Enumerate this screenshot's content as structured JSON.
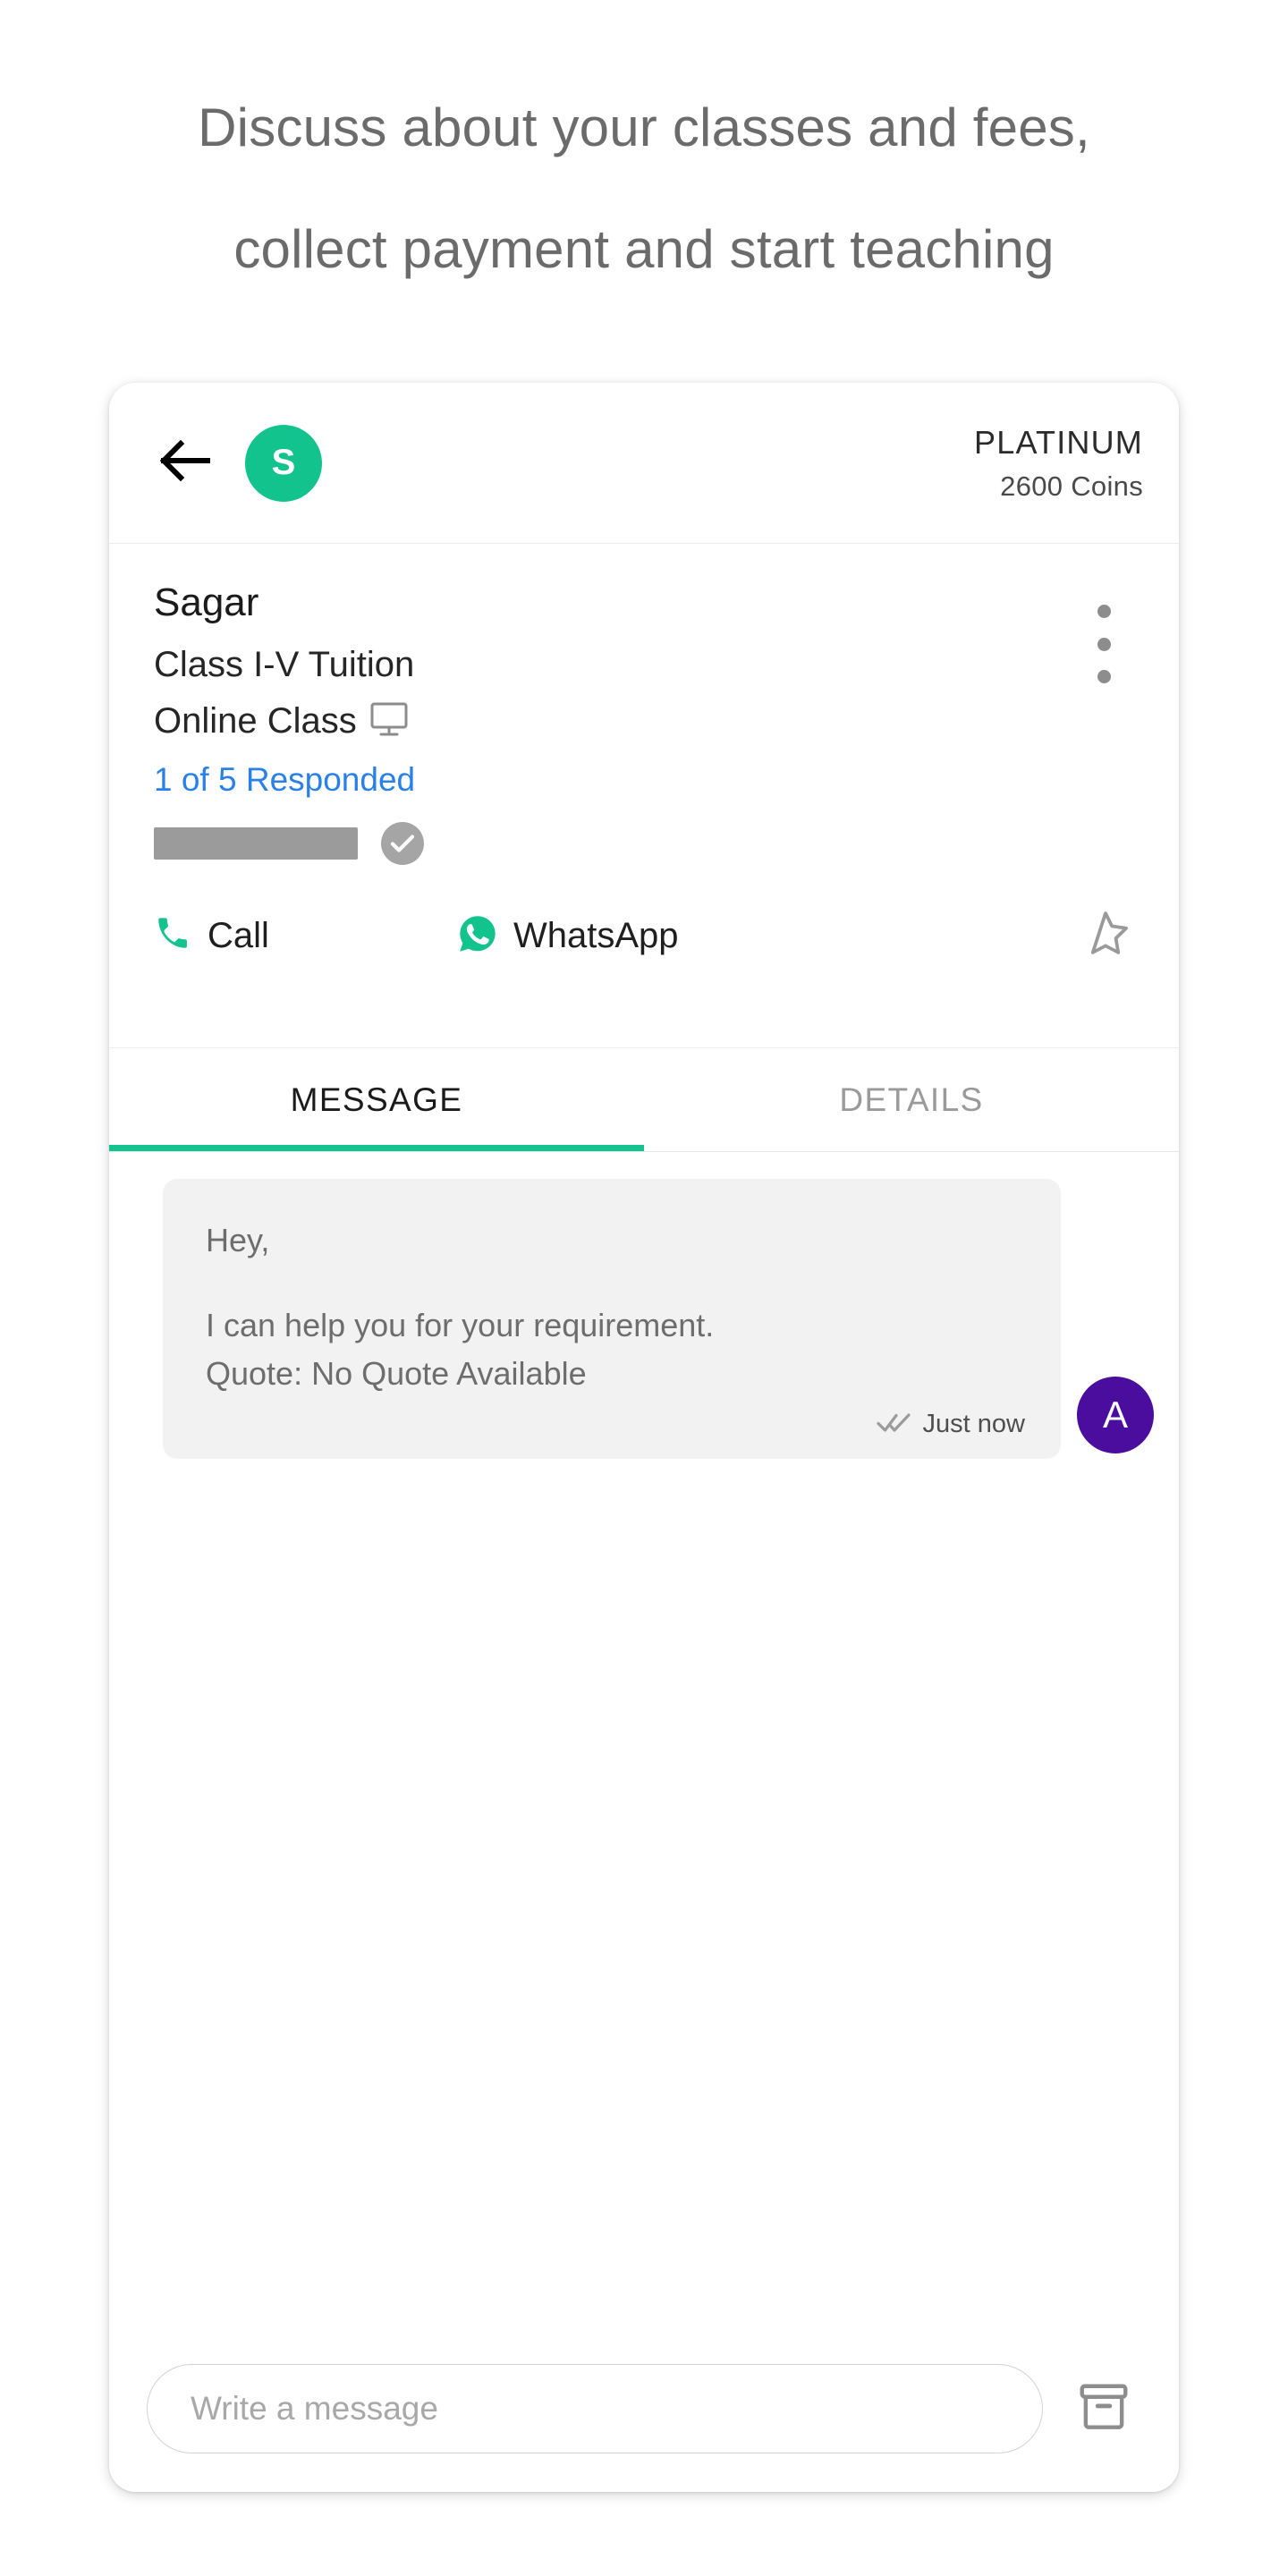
{
  "headline": {
    "line1": "Discuss about your classes and fees,",
    "line2": "collect payment and start teaching"
  },
  "colors": {
    "brand_green": "#12c38e",
    "link_blue": "#2980e8",
    "avatar_purple": "#4a0d9e",
    "muted_grey": "#9b9b9b",
    "bubble_bg": "#f2f2f2"
  },
  "appbar": {
    "back_icon": "arrow-left-icon",
    "avatar_initial": "S",
    "plan_name": "PLATINUM",
    "coins": "2600 Coins"
  },
  "contact": {
    "name": "Sagar",
    "requirement": "Class I-V Tuition",
    "mode": "Online Class",
    "mode_icon": "monitor-icon",
    "responded": "1 of 5 Responded",
    "phone_masked": true,
    "verified_icon": "check-circle-icon",
    "menu_icon": "kebab-menu-icon"
  },
  "actions": {
    "call_label": "Call",
    "call_icon": "phone-icon",
    "whatsapp_label": "WhatsApp",
    "whatsapp_icon": "whatsapp-icon",
    "favorite_icon": "star-outline-icon"
  },
  "tabs": [
    {
      "label": "MESSAGE",
      "active": true
    },
    {
      "label": "DETAILS",
      "active": false
    }
  ],
  "message": {
    "greeting": "Hey,",
    "body_line1": "I can help you for your requirement.",
    "body_line2": "Quote: No Quote Available",
    "status_icon": "double-check-icon",
    "timestamp": "Just now",
    "sender_initial": "A"
  },
  "composer": {
    "placeholder": "Write a message",
    "value": "",
    "archive_icon": "archive-box-icon"
  }
}
